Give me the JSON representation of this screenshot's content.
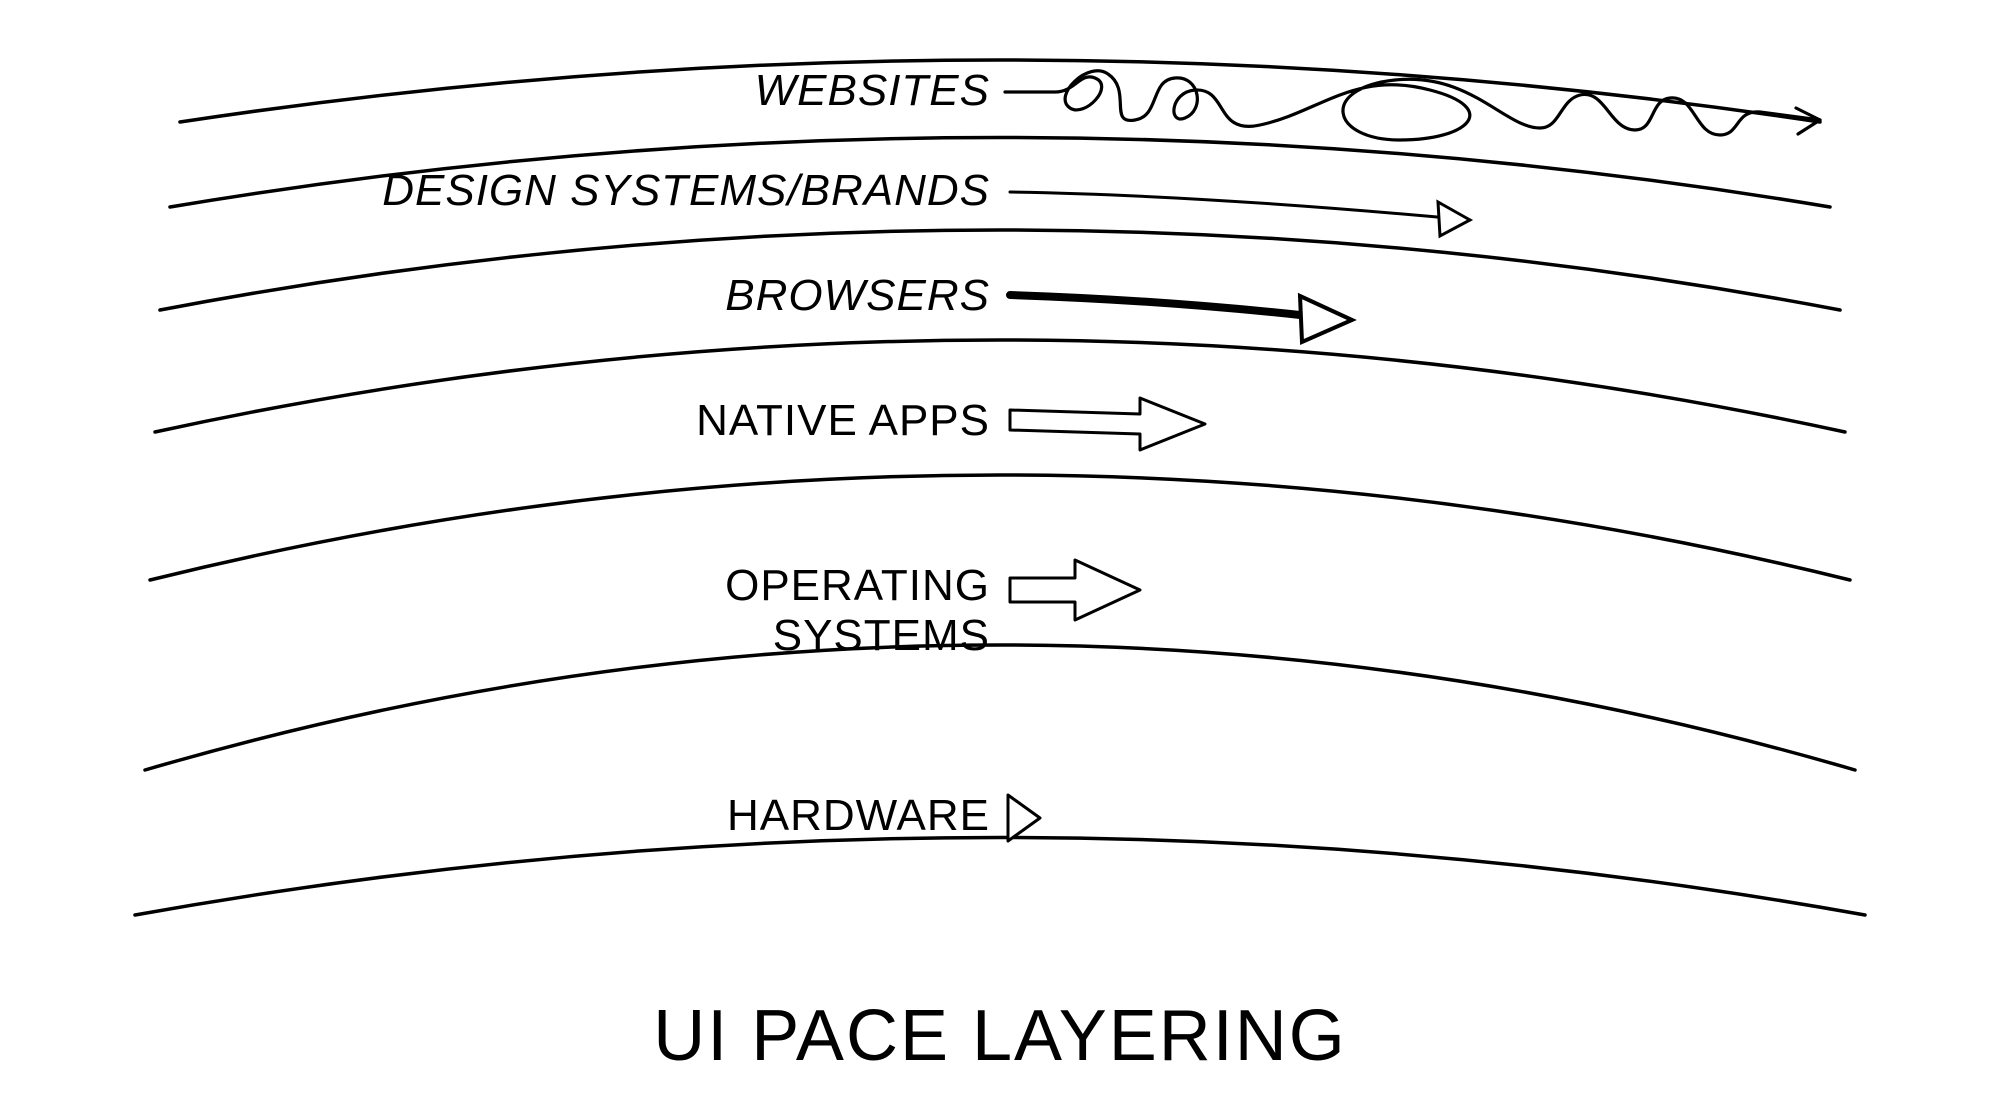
{
  "title": "UI PACE LAYERING",
  "layers": [
    {
      "label": "WEBSITES",
      "italic": true
    },
    {
      "label": "DESIGN SYSTEMS/BRANDS",
      "italic": true
    },
    {
      "label": "BROWSERS",
      "italic": true
    },
    {
      "label": "NATIVE APPS",
      "italic": false
    },
    {
      "label": "OPERATING\nSYSTEMS",
      "italic": false
    },
    {
      "label": "HARDWARE",
      "italic": false
    }
  ]
}
